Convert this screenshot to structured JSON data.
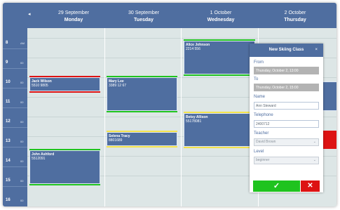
{
  "header": {
    "prev_icon": "◂",
    "days": [
      {
        "date": "29 September",
        "weekday": "Monday"
      },
      {
        "date": "30 September",
        "weekday": "Tuesday"
      },
      {
        "date": "1 October",
        "weekday": "Wednesday"
      },
      {
        "date": "2 October",
        "weekday": "Thursday"
      }
    ]
  },
  "hours": [
    "8",
    "9",
    "10",
    "11",
    "12",
    "13",
    "14",
    "15",
    "16"
  ],
  "hour_suffix": [
    "AM",
    "00",
    "00",
    "00",
    "00",
    "00",
    "00",
    "00",
    "00"
  ],
  "events": [
    {
      "name": "Jack Wilson",
      "phone": "5510 9805"
    },
    {
      "name": "Mary Lee",
      "phone": "3389 12 67"
    },
    {
      "name": "Alice Johnson",
      "phone": "2214 556"
    },
    {
      "name": "Betsy Allison",
      "phone": "55178081"
    },
    {
      "name": "Selena Tracy",
      "phone": "8801689"
    },
    {
      "name": "John Ashford",
      "phone": "5512091"
    }
  ],
  "dialog": {
    "title": "New Skiing Class",
    "close_icon": "×",
    "from_label": "From",
    "from_value": "Thursday, October 2, 13:00",
    "to_label": "To",
    "to_value": "Thursday, October 2, 15:00",
    "name_label": "Name",
    "name_value": "Ann Steward",
    "telephone_label": "Telephone",
    "telephone_value": "2400712",
    "teacher_label": "Teacher",
    "teacher_value": "David Brown",
    "level_label": "Level",
    "level_value": "beginner",
    "ok_icon": "✓",
    "cancel_icon": "✕"
  },
  "colors": {
    "header": "#4f6ea0",
    "grid": "#dde6e6",
    "event": "#4f6ea0",
    "red": "#dd1313",
    "green": "#1fc31f",
    "yellow": "#f2e24c"
  }
}
